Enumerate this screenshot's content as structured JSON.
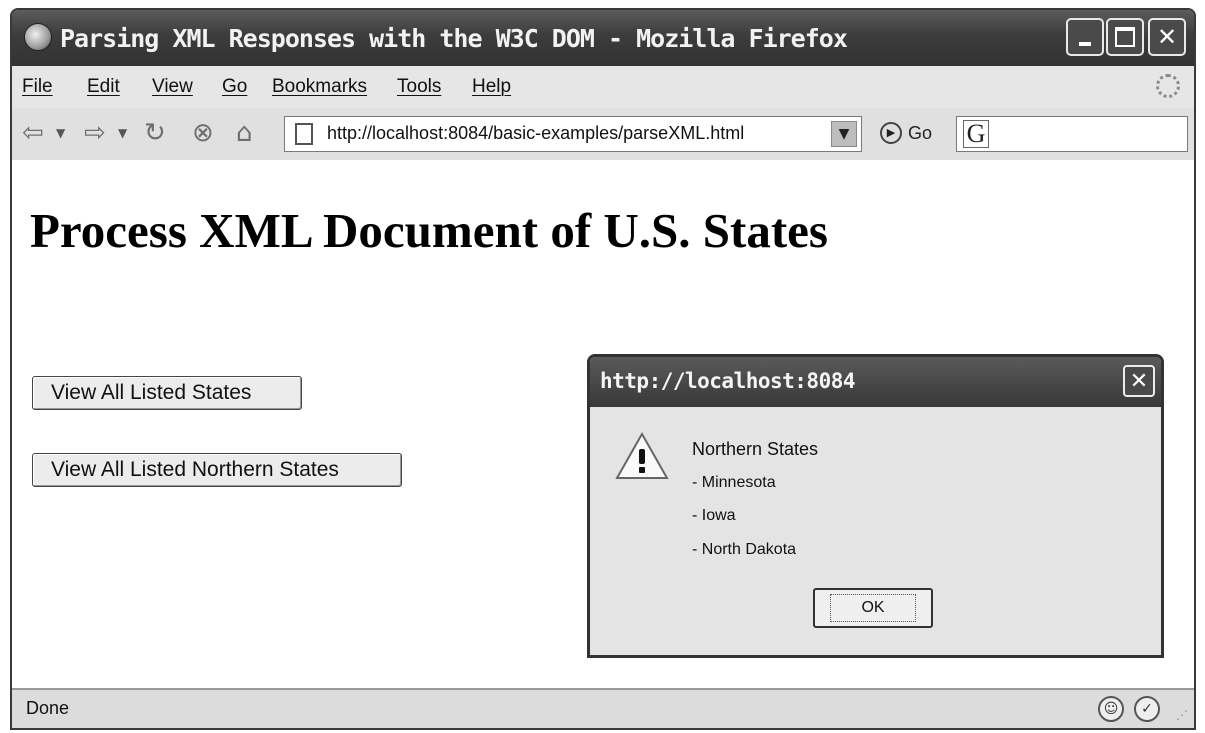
{
  "window": {
    "title": "Parsing XML Responses with the W3C DOM - Mozilla Firefox"
  },
  "menubar": {
    "items": [
      {
        "label": "File"
      },
      {
        "label": "Edit"
      },
      {
        "label": "View"
      },
      {
        "label": "Go"
      },
      {
        "label": "Bookmarks"
      },
      {
        "label": "Tools"
      },
      {
        "label": "Help"
      }
    ]
  },
  "navbar": {
    "url": "http://localhost:8084/basic-examples/parseXML.html",
    "go_label": "Go",
    "search_glyph": "G",
    "icons": [
      "back-icon",
      "forward-icon",
      "reload-icon",
      "stop-icon",
      "home-icon"
    ]
  },
  "page": {
    "heading": "Process XML Document of U.S. States",
    "button_all": "View All Listed States",
    "button_northern": "View All Listed Northern States"
  },
  "dialog": {
    "title": "http://localhost:8084",
    "lines": [
      "Northern States",
      "- Minnesota",
      "- Iowa",
      "- North Dakota"
    ],
    "ok_label": "OK"
  },
  "status": {
    "text": "Done"
  }
}
